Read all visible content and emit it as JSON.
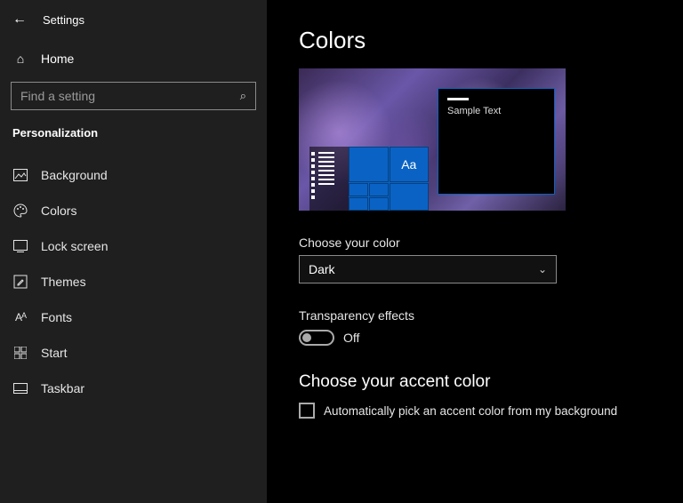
{
  "app_title": "Settings",
  "home_label": "Home",
  "search": {
    "placeholder": "Find a setting"
  },
  "section": "Personalization",
  "nav": [
    {
      "icon": "picture-icon",
      "glyph": "▭",
      "label": "Background"
    },
    {
      "icon": "palette-icon",
      "glyph": "🎨",
      "label": "Colors"
    },
    {
      "icon": "lock-screen-icon",
      "glyph": "⎚",
      "label": "Lock screen"
    },
    {
      "icon": "themes-icon",
      "glyph": "✎",
      "label": "Themes"
    },
    {
      "icon": "fonts-icon",
      "glyph": "Aᴀ",
      "label": "Fonts"
    },
    {
      "icon": "start-icon",
      "glyph": "▦",
      "label": "Start"
    },
    {
      "icon": "taskbar-icon",
      "glyph": "▭",
      "label": "Taskbar"
    }
  ],
  "page_title": "Colors",
  "preview": {
    "sample_text": "Sample Text",
    "aa": "Aa"
  },
  "color_mode": {
    "label": "Choose your color",
    "value": "Dark"
  },
  "transparency": {
    "label": "Transparency effects",
    "state": "Off"
  },
  "accent": {
    "title": "Choose your accent color",
    "auto_label": "Automatically pick an accent color from my background",
    "auto_checked": false
  }
}
